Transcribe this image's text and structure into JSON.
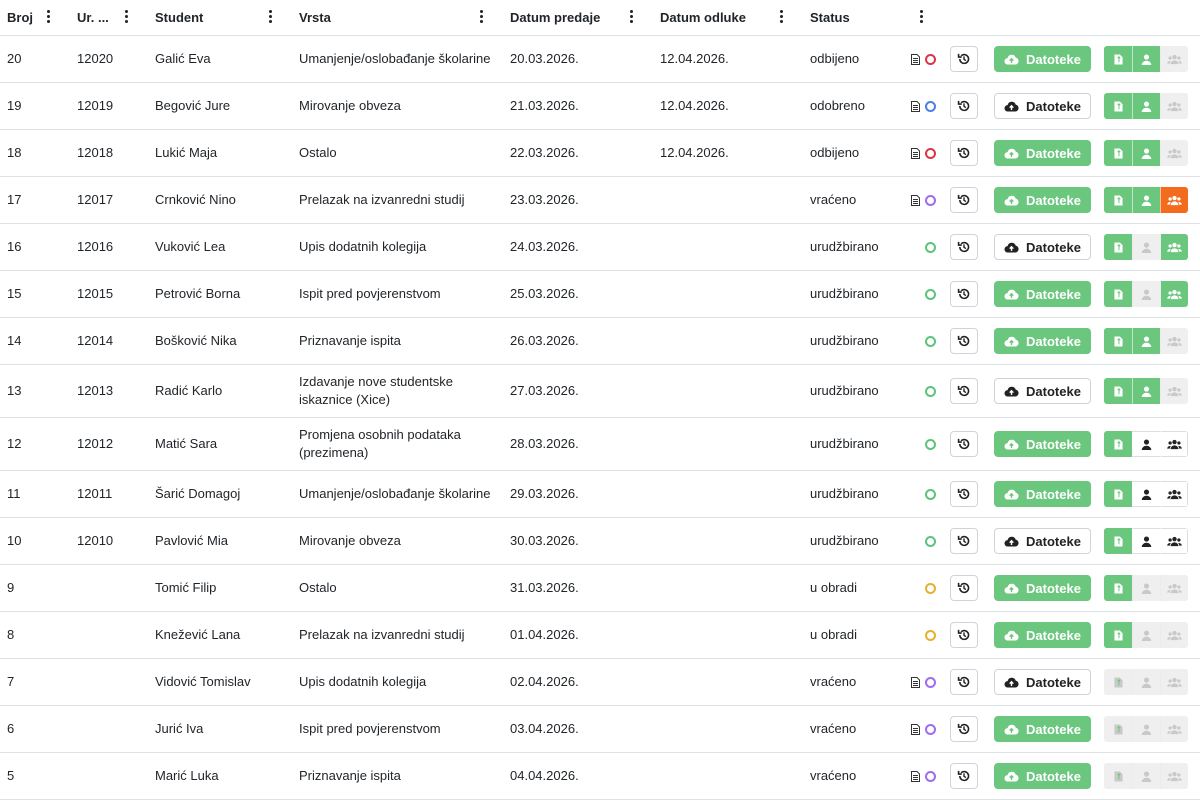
{
  "columns": [
    "Broj",
    "Ur. ...",
    "Student",
    "Vrsta",
    "Datum predaje",
    "Datum odluke",
    "Status"
  ],
  "files_label": "Datoteke",
  "colors": {
    "green": "#6cc77e",
    "orange": "#f36b1c",
    "gray": "#efefef",
    "dot_red": "#dc3545",
    "dot_blue": "#4e7de5",
    "dot_purple": "#a06bf2",
    "dot_green": "#5cc47a",
    "dot_yellow": "#e2b12d"
  },
  "rows": [
    {
      "broj": "20",
      "ur": "12020",
      "student": "Galić Eva",
      "vrsta": "Umanjenje/oslobađanje školarine",
      "predaja": "20.03.2026.",
      "odluka": "12.04.2026.",
      "status": "odbijeno",
      "doc": true,
      "dot": "red",
      "files": "green",
      "seg": [
        "green",
        "green",
        "gray"
      ]
    },
    {
      "broj": "19",
      "ur": "12019",
      "student": "Begović Jure",
      "vrsta": "Mirovanje obveza",
      "predaja": "21.03.2026.",
      "odluka": "12.04.2026.",
      "status": "odobreno",
      "doc": true,
      "dot": "blue",
      "files": "white",
      "seg": [
        "green",
        "green",
        "gray"
      ]
    },
    {
      "broj": "18",
      "ur": "12018",
      "student": "Lukić Maja",
      "vrsta": "Ostalo",
      "predaja": "22.03.2026.",
      "odluka": "12.04.2026.",
      "status": "odbijeno",
      "doc": true,
      "dot": "red",
      "files": "green",
      "seg": [
        "green",
        "green",
        "gray"
      ]
    },
    {
      "broj": "17",
      "ur": "12017",
      "student": "Crnković Nino",
      "vrsta": "Prelazak na izvanredni studij",
      "predaja": "23.03.2026.",
      "odluka": "",
      "status": "vraćeno",
      "doc": true,
      "dot": "purple",
      "files": "green",
      "seg": [
        "green",
        "green",
        "orange"
      ]
    },
    {
      "broj": "16",
      "ur": "12016",
      "student": "Vuković Lea",
      "vrsta": "Upis dodatnih kolegija",
      "predaja": "24.03.2026.",
      "odluka": "",
      "status": "urudžbirano",
      "doc": false,
      "dot": "green",
      "files": "white",
      "seg": [
        "green",
        "gray",
        "green"
      ]
    },
    {
      "broj": "15",
      "ur": "12015",
      "student": "Petrović Borna",
      "vrsta": "Ispit pred povjerenstvom",
      "predaja": "25.03.2026.",
      "odluka": "",
      "status": "urudžbirano",
      "doc": false,
      "dot": "green",
      "files": "green",
      "seg": [
        "green",
        "gray",
        "green"
      ]
    },
    {
      "broj": "14",
      "ur": "12014",
      "student": "Bošković Nika",
      "vrsta": "Priznavanje ispita",
      "predaja": "26.03.2026.",
      "odluka": "",
      "status": "urudžbirano",
      "doc": false,
      "dot": "green",
      "files": "green",
      "seg": [
        "green",
        "green",
        "gray"
      ]
    },
    {
      "broj": "13",
      "ur": "12013",
      "student": "Radić Karlo",
      "vrsta": "Izdavanje nove studentske iskaznice (Xice)",
      "predaja": "27.03.2026.",
      "odluka": "",
      "status": "urudžbirano",
      "doc": false,
      "dot": "green",
      "files": "white",
      "seg": [
        "green",
        "green",
        "gray"
      ]
    },
    {
      "broj": "12",
      "ur": "12012",
      "student": "Matić Sara",
      "vrsta": "Promjena osobnih podataka (prezimena)",
      "predaja": "28.03.2026.",
      "odluka": "",
      "status": "urudžbirano",
      "doc": false,
      "dot": "green",
      "files": "green",
      "seg": [
        "green",
        "white",
        "white"
      ]
    },
    {
      "broj": "11",
      "ur": "12011",
      "student": "Šarić Domagoj",
      "vrsta": "Umanjenje/oslobađanje školarine",
      "predaja": "29.03.2026.",
      "odluka": "",
      "status": "urudžbirano",
      "doc": false,
      "dot": "green",
      "files": "green",
      "seg": [
        "green",
        "white",
        "white"
      ]
    },
    {
      "broj": "10",
      "ur": "12010",
      "student": "Pavlović Mia",
      "vrsta": "Mirovanje obveza",
      "predaja": "30.03.2026.",
      "odluka": "",
      "status": "urudžbirano",
      "doc": false,
      "dot": "green",
      "files": "white",
      "seg": [
        "green",
        "white",
        "white"
      ]
    },
    {
      "broj": "9",
      "ur": "",
      "student": "Tomić Filip",
      "vrsta": "Ostalo",
      "predaja": "31.03.2026.",
      "odluka": "",
      "status": "u obradi",
      "doc": false,
      "dot": "yellow",
      "files": "green",
      "seg": [
        "green",
        "gray",
        "gray"
      ]
    },
    {
      "broj": "8",
      "ur": "",
      "student": "Knežević Lana",
      "vrsta": "Prelazak na izvanredni studij",
      "predaja": "01.04.2026.",
      "odluka": "",
      "status": "u obradi",
      "doc": false,
      "dot": "yellow",
      "files": "green",
      "seg": [
        "green",
        "gray",
        "gray"
      ]
    },
    {
      "broj": "7",
      "ur": "",
      "student": "Vidović Tomislav",
      "vrsta": "Upis dodatnih kolegija",
      "predaja": "02.04.2026.",
      "odluka": "",
      "status": "vraćeno",
      "doc": true,
      "dot": "purple",
      "files": "white",
      "seg": [
        "gray",
        "gray",
        "gray"
      ]
    },
    {
      "broj": "6",
      "ur": "",
      "student": "Jurić Iva",
      "vrsta": "Ispit pred povjerenstvom",
      "predaja": "03.04.2026.",
      "odluka": "",
      "status": "vraćeno",
      "doc": true,
      "dot": "purple",
      "files": "green",
      "seg": [
        "gray",
        "gray",
        "gray"
      ]
    },
    {
      "broj": "5",
      "ur": "",
      "student": "Marić Luka",
      "vrsta": "Priznavanje ispita",
      "predaja": "04.04.2026.",
      "odluka": "",
      "status": "vraćeno",
      "doc": true,
      "dot": "purple",
      "files": "green",
      "seg": [
        "gray",
        "gray",
        "gray"
      ]
    }
  ]
}
